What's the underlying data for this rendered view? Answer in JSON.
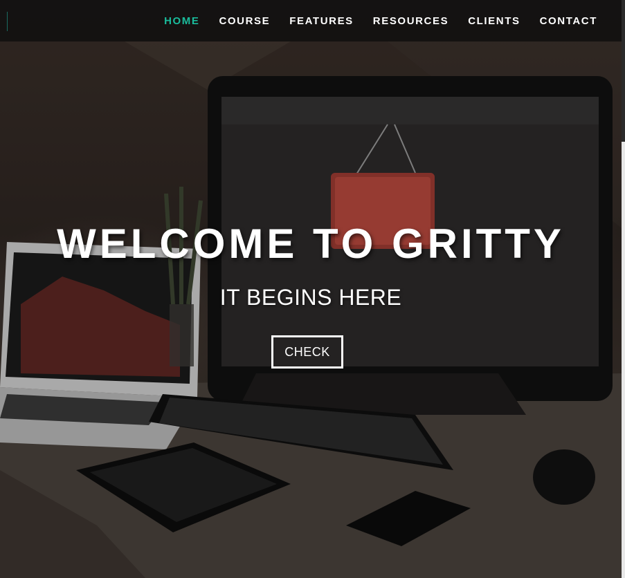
{
  "nav": {
    "items": [
      {
        "label": "HOME",
        "active": true
      },
      {
        "label": "COURSE",
        "active": false
      },
      {
        "label": "FEATURES",
        "active": false
      },
      {
        "label": "RESOURCES",
        "active": false
      },
      {
        "label": "CLIENTS",
        "active": false
      },
      {
        "label": "CONTACT",
        "active": false
      }
    ],
    "active_color": "#1abc9c"
  },
  "hero": {
    "title": "WELCOME TO GRITTY",
    "subtitle": "IT BEGINS HERE",
    "button_label": "CHECK",
    "background_image": "desk-workspace-photo"
  }
}
